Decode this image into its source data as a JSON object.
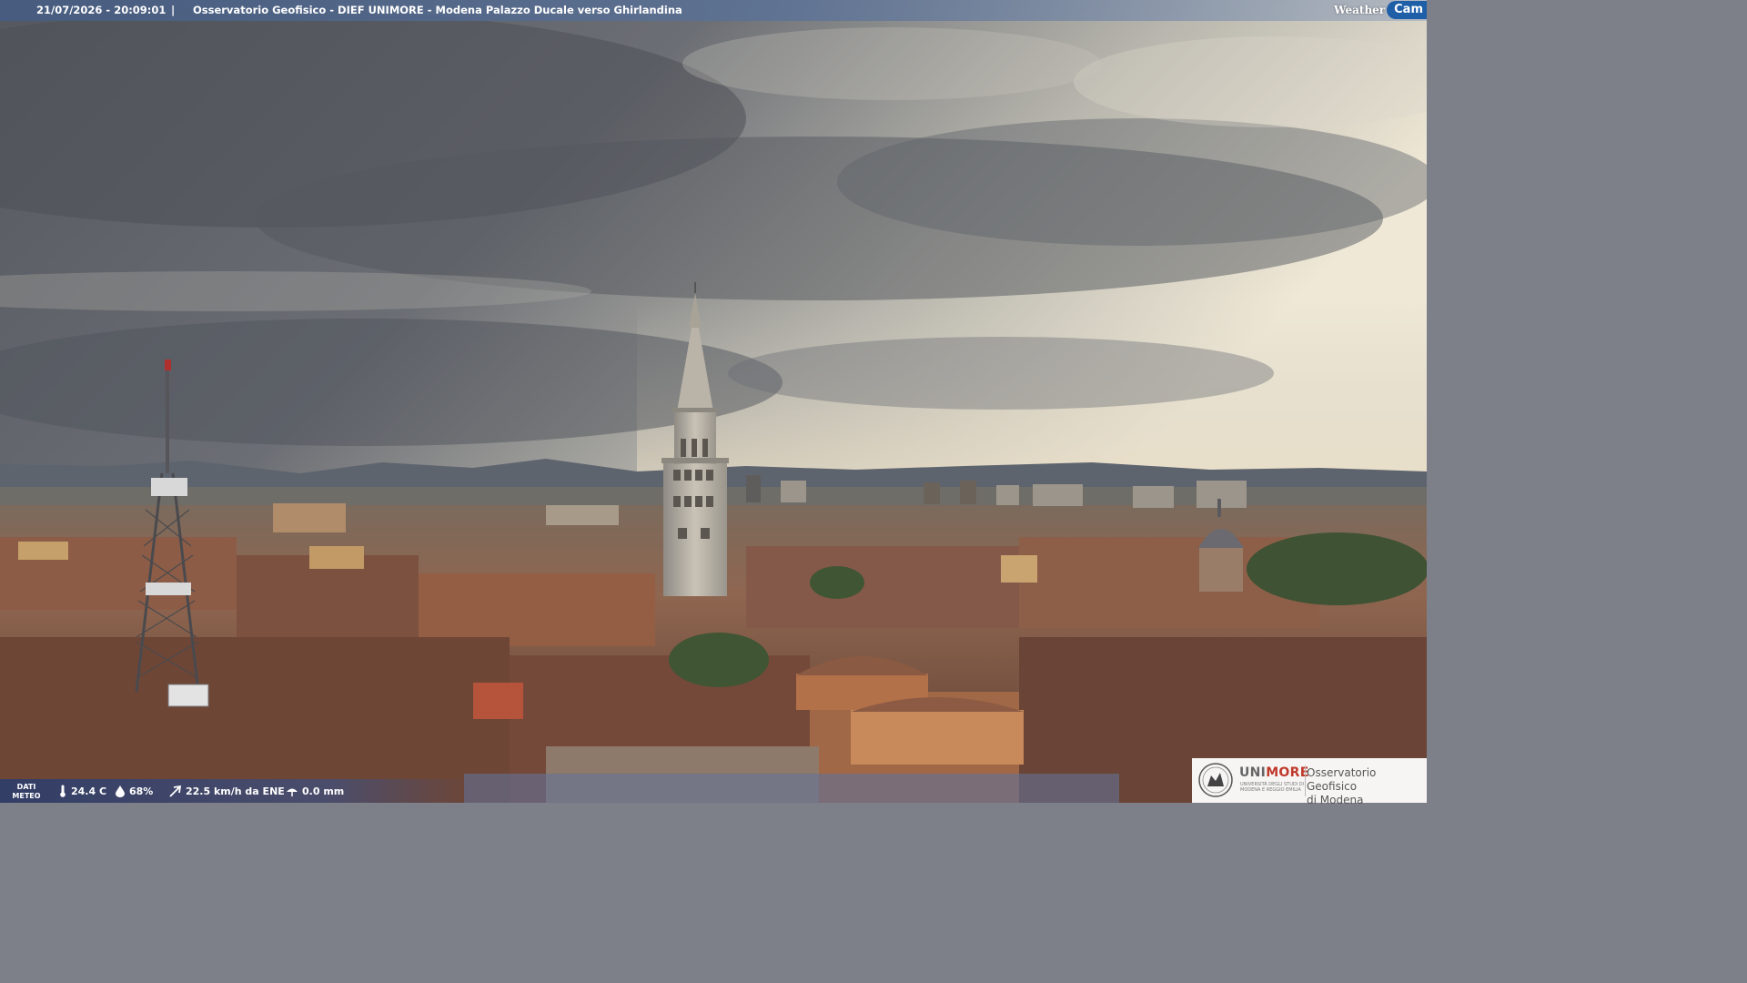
{
  "overlay": {
    "timestamp": "21/07/2026 - 20:09:01",
    "separator": "|",
    "title": "Osservatorio Geofisico - DIEF UNIMORE - Modena Palazzo Ducale verso Ghirlandina",
    "brand_weather": "Weather",
    "brand_cam": "Cam"
  },
  "weather": {
    "label_line1": "DATI",
    "label_line2": "METEO",
    "temperature": "24.4 C",
    "humidity": "68%",
    "wind": "22.5 km/h da ENE",
    "rain": "0.0 mm",
    "icons": [
      "thermometer-icon",
      "humidity-drop-icon",
      "wind-icon",
      "rain-icon"
    ]
  },
  "logo": {
    "uni_prefix": "UNI",
    "uni_suffix": "MORE",
    "uni_sub_line1": "UNIVERSITÀ DEGLI STUDI DI",
    "uni_sub_line2": "MODENA E REGGIO EMILIA",
    "observatory_line1": "Osservatorio Geofisico",
    "observatory_line2": "di Modena"
  },
  "colors": {
    "sky_dark": "#5d6068",
    "sky_light": "#f0ede2",
    "roof": "#8a5a44",
    "brand_blue": "#1f5fa8",
    "unimore_red": "#c0392b"
  }
}
